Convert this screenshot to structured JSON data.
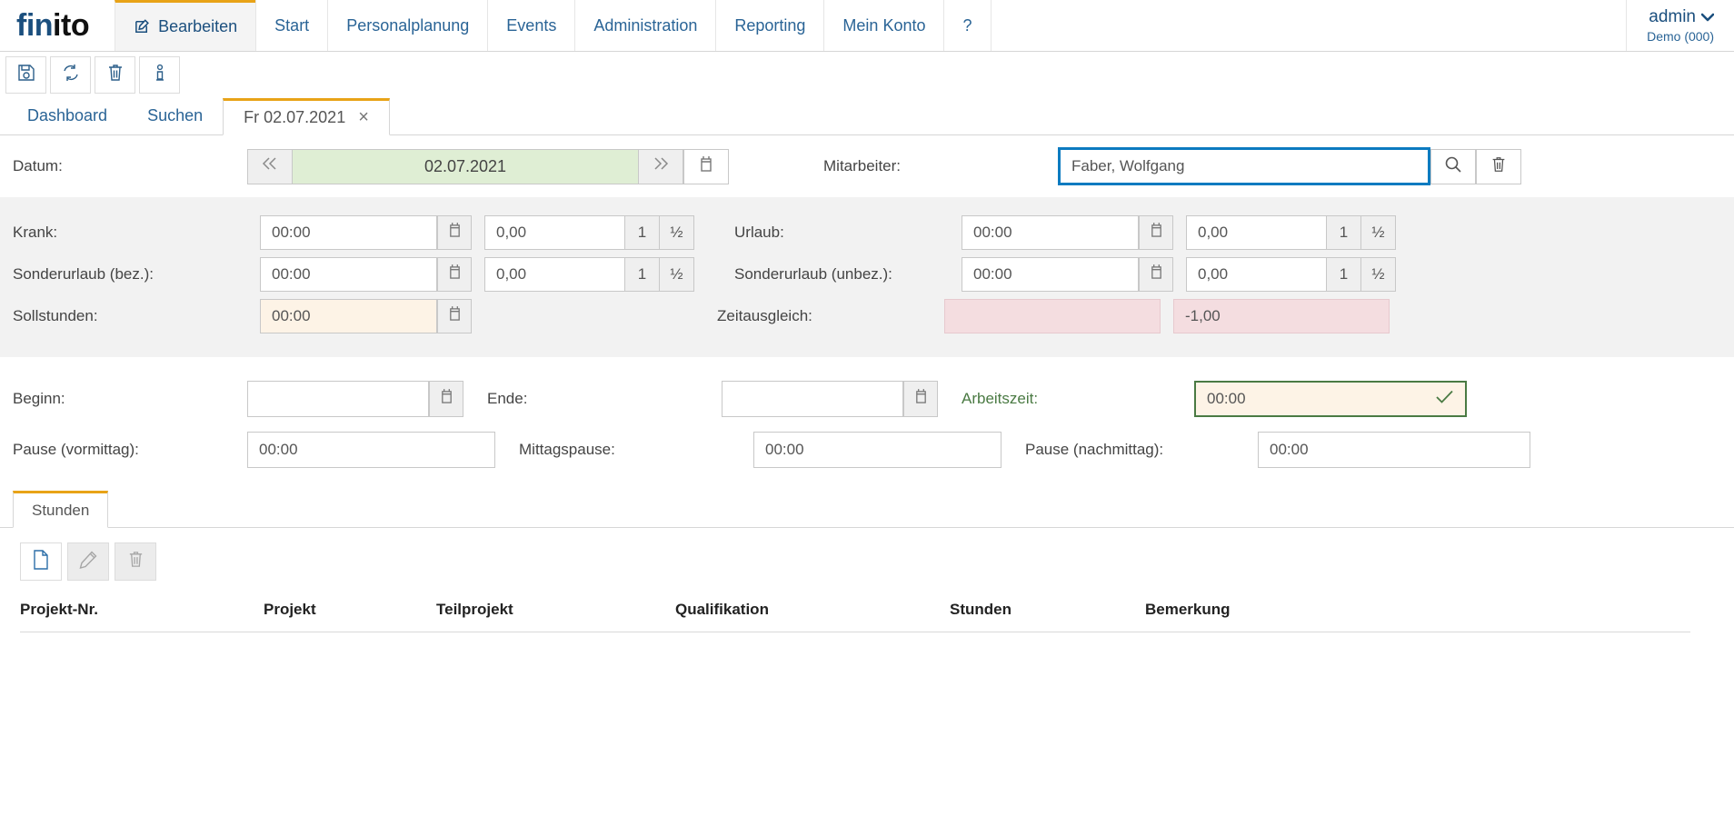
{
  "brand": {
    "part1": "fin",
    "part2": "i",
    "part3": "to"
  },
  "topnav": {
    "items": [
      {
        "label": "Bearbeiten",
        "icon": "edit-icon",
        "active": true
      },
      {
        "label": "Start",
        "active": false
      },
      {
        "label": "Personalplanung",
        "active": false
      },
      {
        "label": "Events",
        "active": false
      },
      {
        "label": "Administration",
        "active": false
      },
      {
        "label": "Reporting",
        "active": false
      },
      {
        "label": "Mein Konto",
        "active": false
      },
      {
        "label": "?",
        "active": false
      }
    ],
    "user": {
      "name": "admin",
      "tenant": "Demo (000)",
      "caret": "chevron-down-icon"
    }
  },
  "toolbar": {
    "buttons": [
      {
        "name": "save-icon"
      },
      {
        "name": "refresh-icon"
      },
      {
        "name": "delete-icon"
      },
      {
        "name": "info-icon"
      }
    ]
  },
  "tabs": [
    {
      "label": "Dashboard",
      "active": false,
      "closable": false
    },
    {
      "label": "Suchen",
      "active": false,
      "closable": false
    },
    {
      "label": "Fr 02.07.2021",
      "active": true,
      "closable": true,
      "close_label": "×"
    }
  ],
  "date_row": {
    "label": "Datum:",
    "prev_icon": "double-chevron-left-icon",
    "value": "02.07.2021",
    "next_icon": "double-chevron-right-icon",
    "calendar_icon": "calendar-icon",
    "employee_label": "Mitarbeiter:",
    "employee_value": "Faber, Wolfgang",
    "search_icon": "search-icon",
    "trash_icon": "trash-icon"
  },
  "absence": {
    "rows": [
      {
        "left_label": "Krank:",
        "left_time": "00:00",
        "left_dec": "0,00",
        "right_label": "Urlaub:",
        "right_time": "00:00",
        "right_dec": "0,00",
        "full_day": "1",
        "half_day": "½"
      },
      {
        "left_label": "Sonderurlaub (bez.):",
        "left_time": "00:00",
        "left_dec": "0,00",
        "right_label": "Sonderurlaub (unbez.):",
        "right_time": "00:00",
        "right_dec": "0,00",
        "full_day": "1",
        "half_day": "½"
      }
    ],
    "soll_label": "Sollstunden:",
    "soll_value": "00:00",
    "zeitausgleich_label": "Zeitausgleich:",
    "zeitausgleich_empty": "",
    "zeitausgleich_value": "-1,00"
  },
  "worktime": {
    "beginn_label": "Beginn:",
    "beginn_value": "",
    "ende_label": "Ende:",
    "ende_value": "",
    "arbeitszeit_label": "Arbeitszeit:",
    "arbeitszeit_value": "00:00",
    "check_icon": "check-icon",
    "pause_vormittag_label": "Pause (vormittag):",
    "pause_vormittag_value": "00:00",
    "mittagspause_label": "Mittagspause:",
    "mittagspause_value": "00:00",
    "pause_nachmittag_label": "Pause (nachmittag):",
    "pause_nachmittag_value": "00:00"
  },
  "hours_section": {
    "tab_label": "Stunden",
    "actions": [
      {
        "name": "new-document-icon",
        "enabled": true
      },
      {
        "name": "edit-pencil-icon",
        "enabled": false
      },
      {
        "name": "delete-trash-icon",
        "enabled": false
      }
    ],
    "columns": [
      "Projekt-Nr.",
      "Projekt",
      "Teilprojekt",
      "Qualifikation",
      "Stunden",
      "Bemerkung"
    ],
    "rows": []
  },
  "colors": {
    "brand_blue": "#1b4f7e",
    "accent_orange": "#e8a317",
    "focus_blue": "#0c7bc0",
    "date_green": "#dfeed4",
    "warn_pink": "#f4dde0",
    "cream": "#fdf3e6",
    "green_border": "#4a7a43"
  }
}
